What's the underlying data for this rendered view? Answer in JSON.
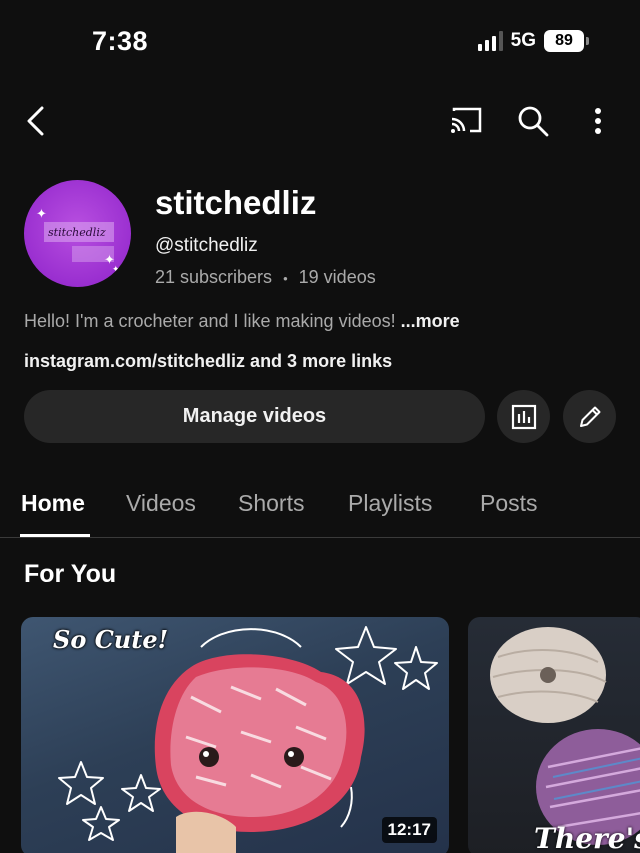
{
  "status_bar": {
    "time": "7:38",
    "network": "5G",
    "battery": "89"
  },
  "channel": {
    "avatar_text": "stitchedliz",
    "name": "stitchedliz",
    "handle": "@stitchedliz",
    "subscribers": "21 subscribers",
    "separator": "•",
    "videos": "19 videos",
    "description": "Hello! I'm a crocheter and I like making videos! ",
    "more_label": "...more",
    "links": "instagram.com/stitchedliz and 3 more links"
  },
  "actions": {
    "manage_label": "Manage videos"
  },
  "tabs": [
    {
      "label": "Home",
      "active": true
    },
    {
      "label": "Videos"
    },
    {
      "label": "Shorts"
    },
    {
      "label": "Playlists"
    },
    {
      "label": "Posts"
    }
  ],
  "section": {
    "title": "For You"
  },
  "videos": [
    {
      "caption": "So Cute!",
      "duration": "12:17"
    },
    {
      "caption": "There's"
    }
  ],
  "icons": {
    "back": "chevron-left-icon",
    "cast": "cast-icon",
    "search": "search-icon",
    "more": "more-vertical-icon",
    "stats": "bar-chart-icon",
    "edit": "pencil-icon"
  },
  "colors": {
    "background": "#0f0f0f",
    "button": "#272727",
    "secondary_text": "#aaaaaa",
    "avatar": "#9a2fd0"
  }
}
